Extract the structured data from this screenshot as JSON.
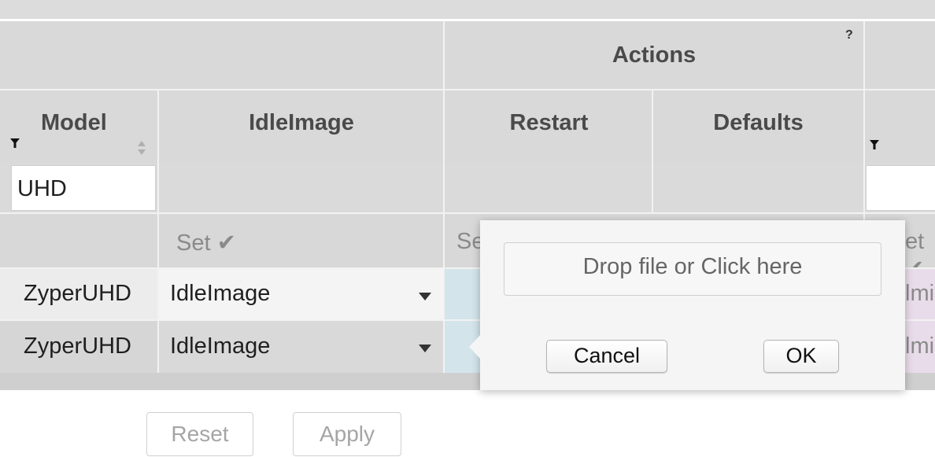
{
  "table": {
    "group_header": {
      "actions_label": "Actions",
      "help_mark": "?"
    },
    "columns": {
      "model": "Model",
      "idle_image": "IdleImage",
      "restart": "Restart",
      "defaults": "Defaults"
    },
    "filters": {
      "model_value": "UHD"
    },
    "set_row": {
      "idle_image_set": "Set ✔",
      "restart_partial": "Se",
      "right_partial": "et ✔"
    },
    "rows": [
      {
        "model": "ZyperUHD",
        "idle_image": "IdleImage",
        "right_partial": "lmi"
      },
      {
        "model": "ZyperUHD",
        "idle_image": "IdleImage",
        "right_partial": "lmi"
      }
    ]
  },
  "popover": {
    "dropzone_label": "Drop file or Click here",
    "cancel_label": "Cancel",
    "ok_label": "OK"
  },
  "footer": {
    "reset_label": "Reset",
    "apply_label": "Apply"
  },
  "colors": {
    "header_bg": "#d9d9d9",
    "row_bg": "#d6d6d6",
    "row_alt_bg": "#ececec",
    "restart_cell_bg": "#d3e4ea",
    "right_cell_bg": "#e9dcea"
  }
}
